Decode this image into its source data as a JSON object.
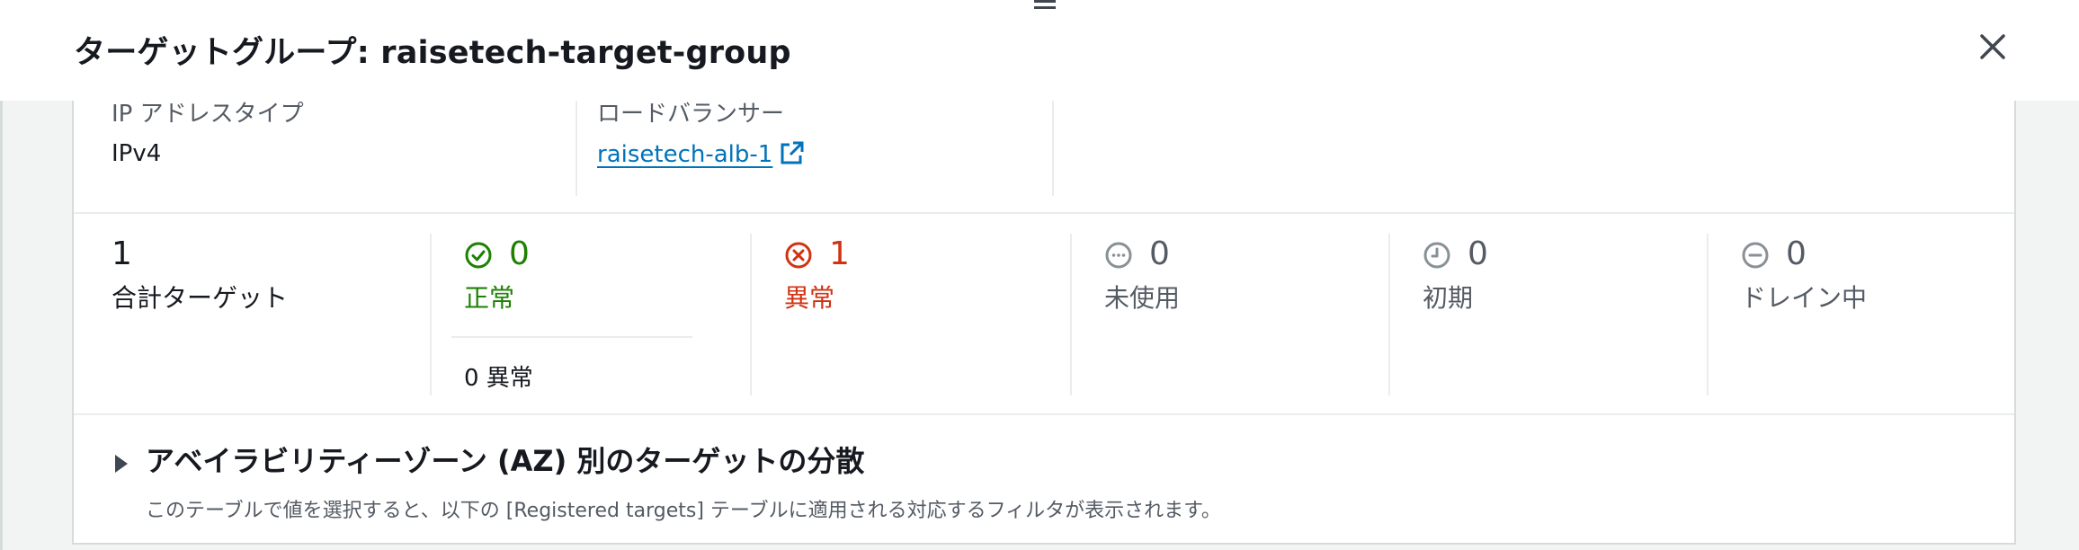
{
  "header": {
    "title": "ターゲットグループ: raisetech-target-group"
  },
  "attributes": {
    "ip_address_type": {
      "label": "IP アドレスタイプ",
      "value": "IPv4"
    },
    "load_balancer": {
      "label": "ロードバランサー",
      "value": "raisetech-alb-1"
    }
  },
  "targets": {
    "total": {
      "count": "1",
      "label": "合計ターゲット"
    },
    "healthy": {
      "count": "0",
      "label": "正常",
      "sub": "0 異常",
      "color": "#1d8102",
      "icon": "check-circle-icon"
    },
    "unhealthy": {
      "count": "1",
      "label": "異常",
      "color": "#d13212",
      "icon": "x-circle-icon"
    },
    "unused": {
      "count": "0",
      "label": "未使用",
      "color": "#687078",
      "icon": "ellipsis-circle-icon"
    },
    "initial": {
      "count": "0",
      "label": "初期",
      "color": "#687078",
      "icon": "clock-icon"
    },
    "draining": {
      "count": "0",
      "label": "ドレイン中",
      "color": "#687078",
      "icon": "minus-circle-icon"
    }
  },
  "az_section": {
    "title": "アベイラビリティーゾーン (AZ) 別のターゲットの分散",
    "description": "このテーブルで値を選択すると、以下の [Registered targets] テーブルに適用される対応するフィルタが表示されます。"
  },
  "colors": {
    "link": "#0073bb",
    "healthy": "#1d8102",
    "unhealthy": "#d13212",
    "neutral": "#687078"
  }
}
